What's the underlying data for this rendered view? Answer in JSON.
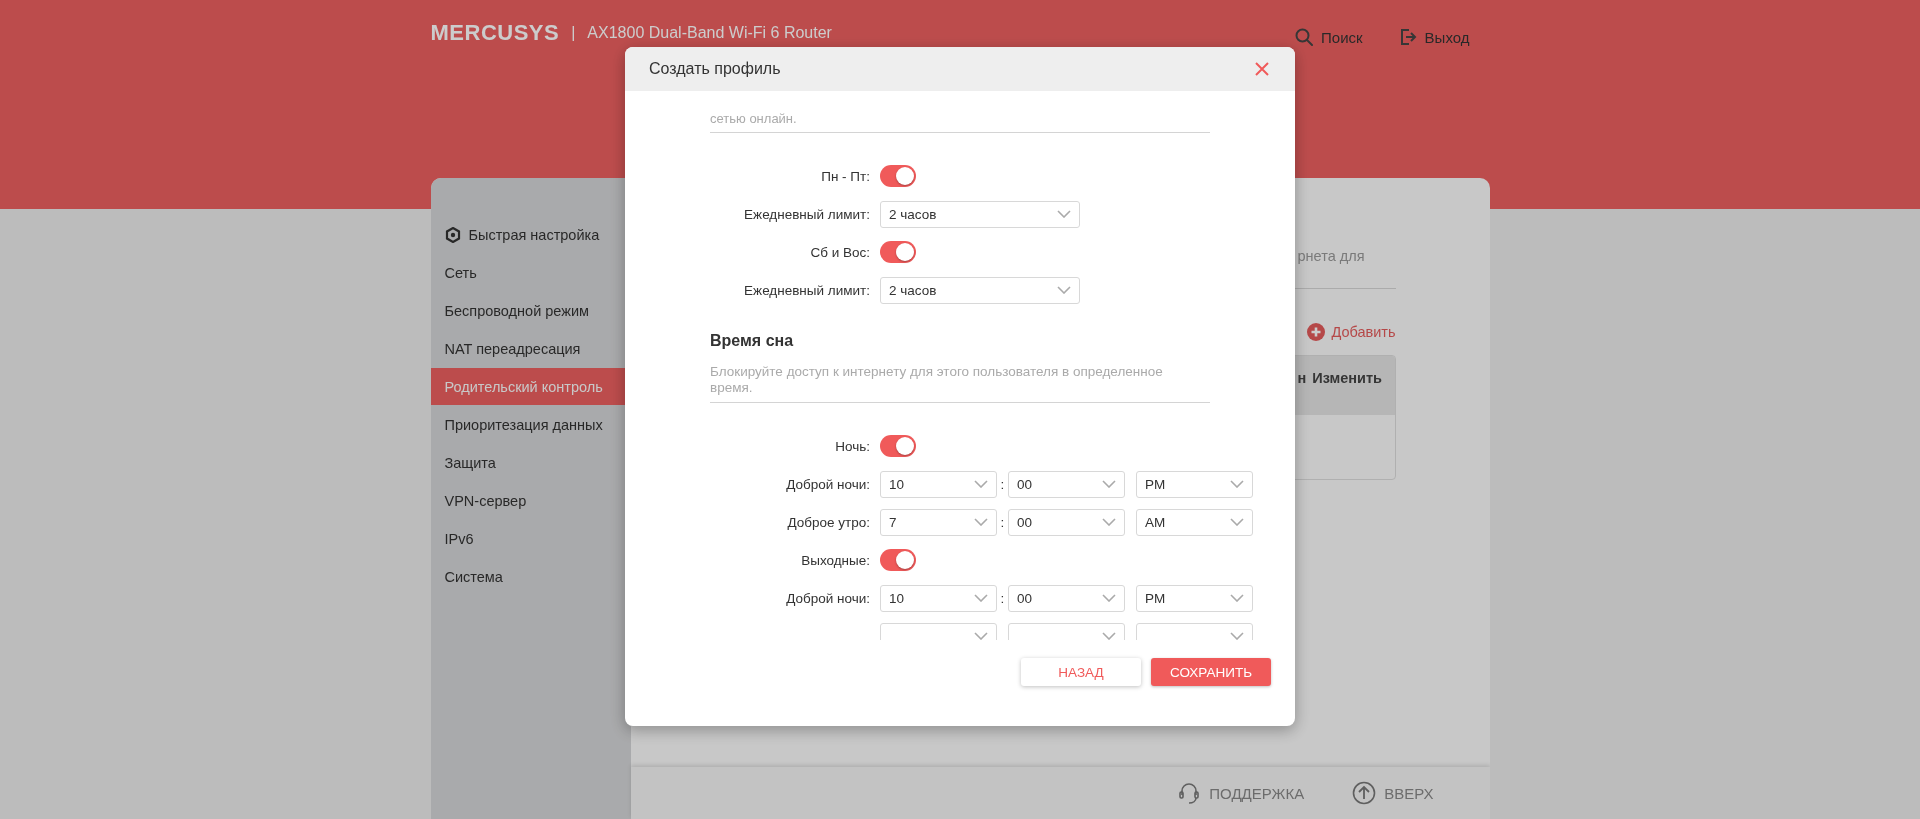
{
  "header": {
    "logo": "MERCUSYS",
    "separator": "|",
    "model": "AX1800 Dual-Band Wi-Fi 6 Router",
    "actions": [
      {
        "label": "Поиск"
      },
      {
        "label": "Выход"
      }
    ]
  },
  "sidebar": {
    "items": [
      {
        "label": "Быстрая настройка",
        "selected": false
      },
      {
        "label": "Сеть",
        "selected": false
      },
      {
        "label": "Беспроводной режим",
        "selected": false
      },
      {
        "label": "NAT переадресация",
        "selected": false
      },
      {
        "label": "Родительский контроль",
        "selected": true
      },
      {
        "label": "Приоритезация данных",
        "selected": false
      },
      {
        "label": "Защита",
        "selected": false
      },
      {
        "label": "VPN-сервер",
        "selected": false
      },
      {
        "label": "IPv6",
        "selected": false
      },
      {
        "label": "Система",
        "selected": false
      }
    ]
  },
  "content": {
    "description": "рнета для",
    "add_button": "Добавить",
    "table": {
      "columns": [
        "н",
        "Изменить"
      ]
    }
  },
  "footer": {
    "links": [
      {
        "label": "ПОДДЕРЖКА"
      },
      {
        "label": "ВВЕРХ"
      }
    ]
  },
  "dialog": {
    "title": "Создать профиль",
    "intro_tail": "сетью онлайн.",
    "time_limits": [
      {
        "kind": "toggle",
        "label": "Пн - Пт:",
        "on": true
      },
      {
        "kind": "select",
        "label": "Ежедневный лимит:",
        "value": "2 часов"
      },
      {
        "kind": "toggle",
        "label": "Сб и Вос:",
        "on": true
      },
      {
        "kind": "select",
        "label": "Ежедневный лимит:",
        "value": "2 часов"
      }
    ],
    "sleep": {
      "title": "Время сна",
      "description": "Блокируйте доступ к интернету для этого пользователя в определенное время.",
      "rows": [
        {
          "kind": "toggle",
          "label": "Ночь:",
          "on": true
        },
        {
          "kind": "time",
          "label": "Доброй ночи:",
          "hour": "10",
          "separator": ":",
          "minute": "00",
          "period": "PM"
        },
        {
          "kind": "time",
          "label": "Доброе утро:",
          "hour": "7",
          "separator": ":",
          "minute": "00",
          "period": "AM"
        },
        {
          "kind": "toggle",
          "label": "Выходные:",
          "on": true
        },
        {
          "kind": "time",
          "label": "Доброй ночи:",
          "hour": "10",
          "separator": ":",
          "minute": "00",
          "period": "PM"
        },
        {
          "kind": "time-partial"
        }
      ]
    },
    "buttons": [
      {
        "label": "НАЗАД",
        "kind": "secondary"
      },
      {
        "label": "СОХРАНИТЬ",
        "kind": "primary"
      }
    ]
  }
}
